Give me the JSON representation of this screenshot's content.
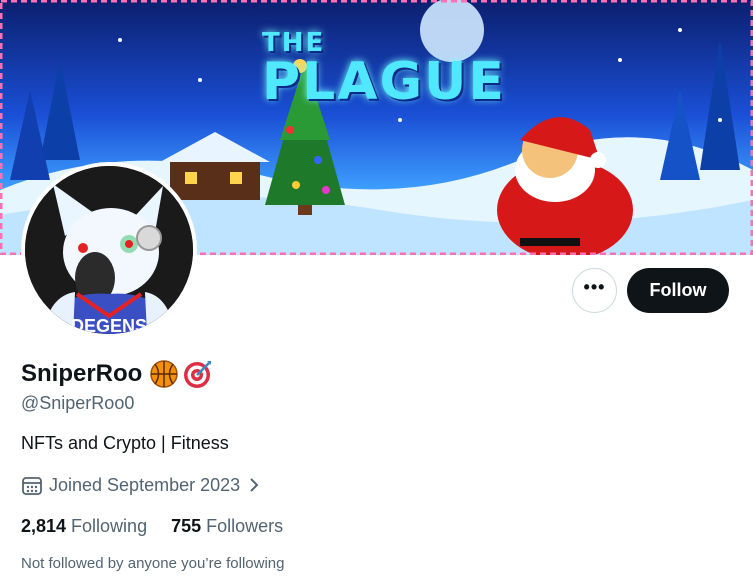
{
  "banner": {
    "title_line1": "THE",
    "title_line2": "PLAGUE"
  },
  "avatar": {
    "jersey_text": "DEGENS"
  },
  "actions": {
    "more_label": "•••",
    "follow_label": "Follow"
  },
  "profile": {
    "display_name": "SniperRoo",
    "emojis": [
      "basketball-emoji",
      "bullseye-emoji"
    ],
    "handle": "@SniperRoo0",
    "bio": "NFTs and Crypto | Fitness",
    "joined": "Joined September 2023",
    "following_count": "2,814",
    "following_label": "Following",
    "followers_count": "755",
    "followers_label": "Followers",
    "not_followed_text": "Not followed by anyone you’re following"
  },
  "colors": {
    "text": "#0f1419",
    "secondary": "#536471",
    "button_dark": "#0f1419",
    "border": "#cfd9de"
  },
  "icons": {
    "calendar": "calendar-icon",
    "chevron": "chevron-right-icon"
  }
}
